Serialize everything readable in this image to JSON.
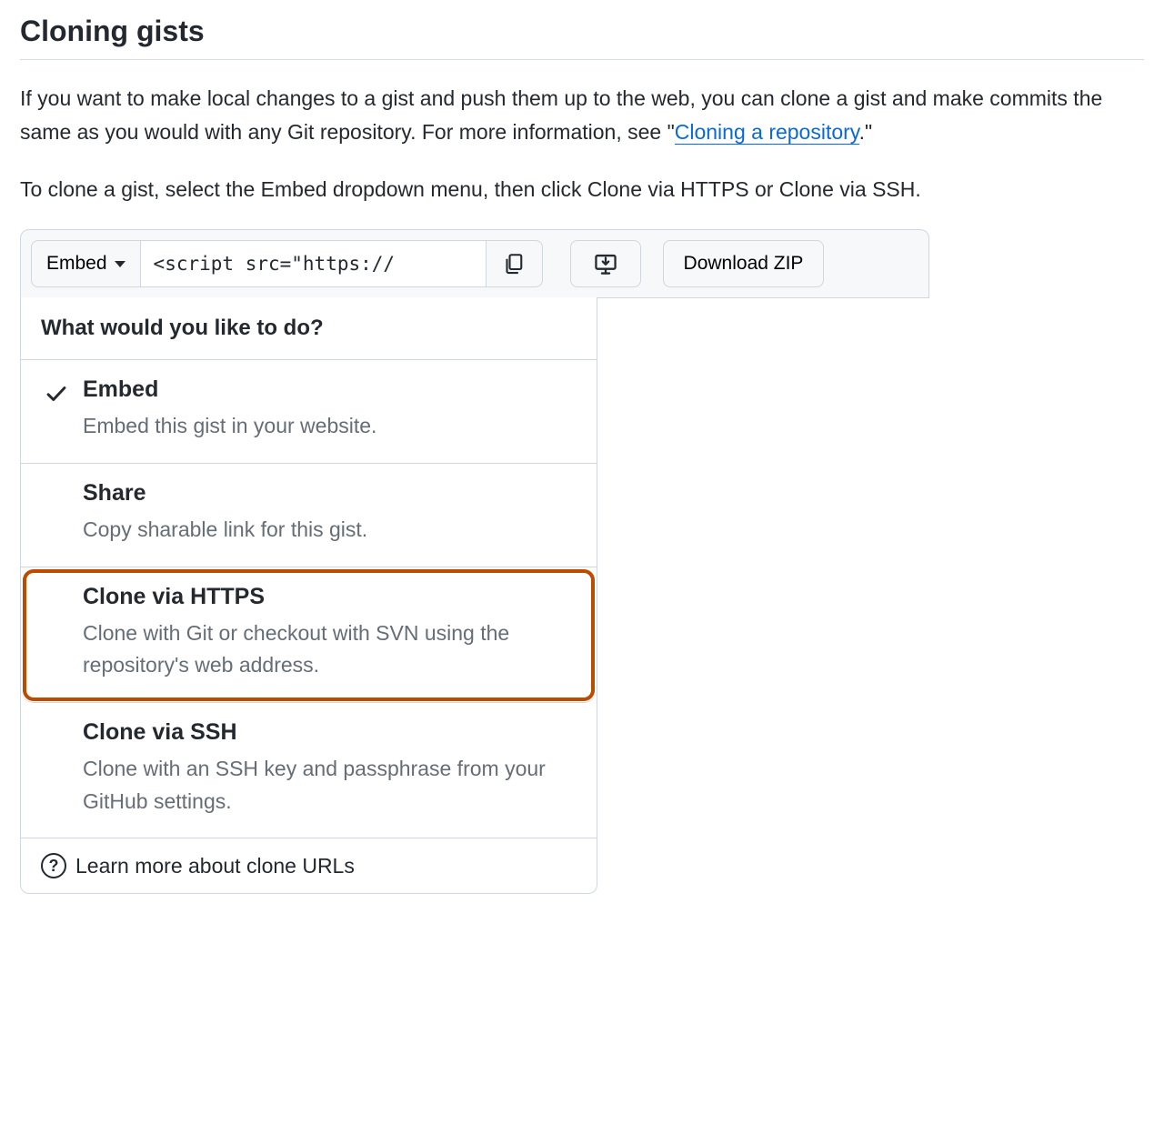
{
  "heading": "Cloning gists",
  "para1": {
    "before": "If you want to make local changes to a gist and push them up to the web, you can clone a gist and make commits the same as you would with any Git repository. For more information, see \"",
    "link": "Cloning a repository",
    "after": ".\""
  },
  "para2": "To clone a gist, select the Embed dropdown menu, then click Clone via HTTPS or Clone via SSH.",
  "toolbar": {
    "embed_label": "Embed",
    "url_value": "<script src=\"https://",
    "download_label": "Download ZIP"
  },
  "dropdown": {
    "header": "What would you like to do?",
    "items": [
      {
        "title": "Embed",
        "desc": "Embed this gist in your website.",
        "selected": true,
        "highlighted": false
      },
      {
        "title": "Share",
        "desc": "Copy sharable link for this gist.",
        "selected": false,
        "highlighted": false
      },
      {
        "title": "Clone via HTTPS",
        "desc": "Clone with Git or checkout with SVN using the repository's web address.",
        "selected": false,
        "highlighted": true
      },
      {
        "title": "Clone via SSH",
        "desc": "Clone with an SSH key and passphrase from your GitHub settings.",
        "selected": false,
        "highlighted": false
      }
    ],
    "footer": "Learn more about clone URLs"
  }
}
